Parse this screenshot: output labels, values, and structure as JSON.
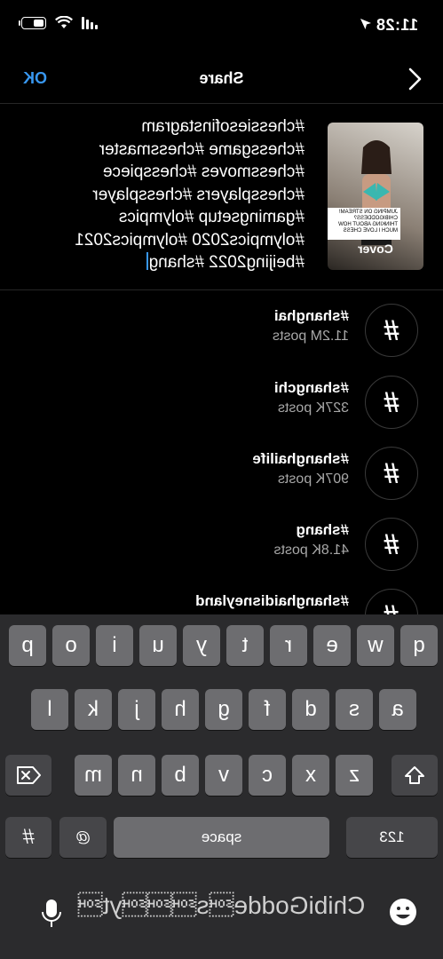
{
  "status_bar": {
    "time": "11:28"
  },
  "nav": {
    "title": "Share",
    "ok_label": "OK"
  },
  "thumbnail": {
    "sticker_text": "JUMPING ON STREAM! CHIBIGODDESS? THINKING ABOUT HOW MUCH I LOVE CHESS",
    "cover_label": "Cover"
  },
  "caption": {
    "lines": [
      "#chessiesofinstagram",
      "#chessgame #chessmaster",
      "#chessmoves #chesspiece",
      "#chessplayers #chessplayer",
      "#gamingsetup #olympics",
      "#olympics2020 #olympics2021",
      "#beijing2022 #shang"
    ]
  },
  "suggestions": [
    {
      "tag": "#shanghai",
      "count": "11.2M posts"
    },
    {
      "tag": "#shangchi",
      "count": "327K posts"
    },
    {
      "tag": "#shanghailife",
      "count": "907K posts"
    },
    {
      "tag": "#shang",
      "count": "41.8K posts"
    },
    {
      "tag": "#shanghaidisneyland",
      "count": ""
    }
  ],
  "keyboard": {
    "row1": [
      "q",
      "w",
      "e",
      "r",
      "t",
      "y",
      "u",
      "i",
      "o",
      "p"
    ],
    "row2": [
      "a",
      "s",
      "d",
      "f",
      "g",
      "h",
      "j",
      "k",
      "l"
    ],
    "row3": [
      "z",
      "x",
      "c",
      "v",
      "b",
      "n",
      "m"
    ],
    "numbers_label": "123",
    "space_label": "space",
    "return_label": "#",
    "at_label": "@"
  },
  "predictive_text": "ChibiGodde\u0001s\u0001\u0001\u0001yt\u0001"
}
